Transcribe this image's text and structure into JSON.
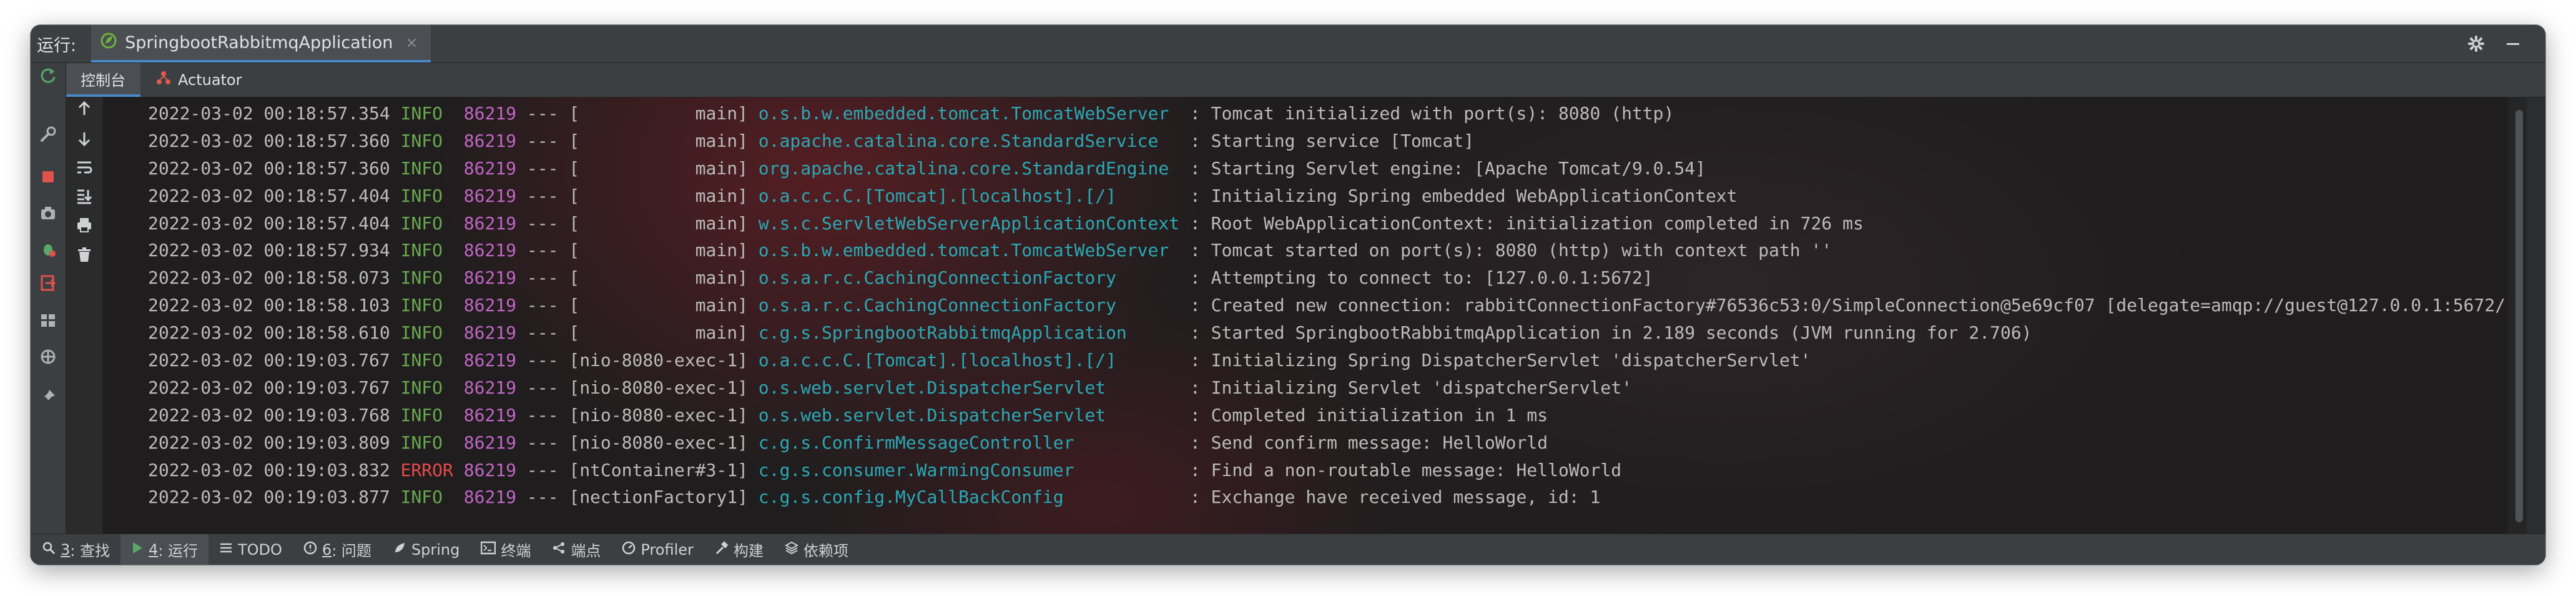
{
  "titlebar": {
    "run_label": "运行:",
    "tab_title": "SpringbootRabbitmqApplication",
    "tab_close": "×",
    "gear_icon": "gear-icon",
    "minimize_icon": "minimize-icon"
  },
  "subtabs": {
    "console": "控制台",
    "actuator": "Actuator"
  },
  "colors": {
    "info": "#6aa84f",
    "error": "#e8494c",
    "pid": "#c066c4",
    "logger": "#2aa9b5",
    "text": "#bbbbbb"
  },
  "log": [
    {
      "ts": "2022-03-02 00:18:57.354",
      "level": "INFO",
      "pid": "86219",
      "sep": "---",
      "thread": "[           main]",
      "logger": "o.s.b.w.embedded.tomcat.TomcatWebServer ",
      "msg": ": Tomcat initialized with port(s): 8080 (http)"
    },
    {
      "ts": "2022-03-02 00:18:57.360",
      "level": "INFO",
      "pid": "86219",
      "sep": "---",
      "thread": "[           main]",
      "logger": "o.apache.catalina.core.StandardService  ",
      "msg": ": Starting service [Tomcat]"
    },
    {
      "ts": "2022-03-02 00:18:57.360",
      "level": "INFO",
      "pid": "86219",
      "sep": "---",
      "thread": "[           main]",
      "logger": "org.apache.catalina.core.StandardEngine ",
      "msg": ": Starting Servlet engine: [Apache Tomcat/9.0.54]"
    },
    {
      "ts": "2022-03-02 00:18:57.404",
      "level": "INFO",
      "pid": "86219",
      "sep": "---",
      "thread": "[           main]",
      "logger": "o.a.c.c.C.[Tomcat].[localhost].[/]      ",
      "msg": ": Initializing Spring embedded WebApplicationContext"
    },
    {
      "ts": "2022-03-02 00:18:57.404",
      "level": "INFO",
      "pid": "86219",
      "sep": "---",
      "thread": "[           main]",
      "logger": "w.s.c.ServletWebServerApplicationContext",
      "msg": ": Root WebApplicationContext: initialization completed in 726 ms"
    },
    {
      "ts": "2022-03-02 00:18:57.934",
      "level": "INFO",
      "pid": "86219",
      "sep": "---",
      "thread": "[           main]",
      "logger": "o.s.b.w.embedded.tomcat.TomcatWebServer ",
      "msg": ": Tomcat started on port(s): 8080 (http) with context path ''"
    },
    {
      "ts": "2022-03-02 00:18:58.073",
      "level": "INFO",
      "pid": "86219",
      "sep": "---",
      "thread": "[           main]",
      "logger": "o.s.a.r.c.CachingConnectionFactory      ",
      "msg": ": Attempting to connect to: [127.0.0.1:5672]"
    },
    {
      "ts": "2022-03-02 00:18:58.103",
      "level": "INFO",
      "pid": "86219",
      "sep": "---",
      "thread": "[           main]",
      "logger": "o.s.a.r.c.CachingConnectionFactory      ",
      "msg": ": Created new connection: rabbitConnectionFactory#76536c53:0/SimpleConnection@5e69cf07 [delegate=amqp://guest@127.0.0.1:5672/,"
    },
    {
      "ts": "2022-03-02 00:18:58.610",
      "level": "INFO",
      "pid": "86219",
      "sep": "---",
      "thread": "[           main]",
      "logger": "c.g.s.SpringbootRabbitmqApplication     ",
      "msg": ": Started SpringbootRabbitmqApplication in 2.189 seconds (JVM running for 2.706)"
    },
    {
      "ts": "2022-03-02 00:19:03.767",
      "level": "INFO",
      "pid": "86219",
      "sep": "---",
      "thread": "[nio-8080-exec-1]",
      "logger": "o.a.c.c.C.[Tomcat].[localhost].[/]      ",
      "msg": ": Initializing Spring DispatcherServlet 'dispatcherServlet'"
    },
    {
      "ts": "2022-03-02 00:19:03.767",
      "level": "INFO",
      "pid": "86219",
      "sep": "---",
      "thread": "[nio-8080-exec-1]",
      "logger": "o.s.web.servlet.DispatcherServlet       ",
      "msg": ": Initializing Servlet 'dispatcherServlet'"
    },
    {
      "ts": "2022-03-02 00:19:03.768",
      "level": "INFO",
      "pid": "86219",
      "sep": "---",
      "thread": "[nio-8080-exec-1]",
      "logger": "o.s.web.servlet.DispatcherServlet       ",
      "msg": ": Completed initialization in 1 ms"
    },
    {
      "ts": "2022-03-02 00:19:03.809",
      "level": "INFO",
      "pid": "86219",
      "sep": "---",
      "thread": "[nio-8080-exec-1]",
      "logger": "c.g.s.ConfirmMessageController          ",
      "msg": ": Send confirm message: HelloWorld"
    },
    {
      "ts": "2022-03-02 00:19:03.832",
      "level": "ERROR",
      "pid": "86219",
      "sep": "---",
      "thread": "[ntContainer#3-1]",
      "logger": "c.g.s.consumer.WarmingConsumer          ",
      "msg": ": Find a non-routable message: HelloWorld"
    },
    {
      "ts": "2022-03-02 00:19:03.877",
      "level": "INFO",
      "pid": "86219",
      "sep": "---",
      "thread": "[nectionFactory1]",
      "logger": "c.g.s.config.MyCallBackConfig           ",
      "msg": ": Exchange have received message, id: 1"
    }
  ],
  "statusbar": [
    {
      "key": "3",
      "label": ": 查找",
      "icon": "search-icon"
    },
    {
      "key": "4",
      "label": ": 运行",
      "icon": "run-icon",
      "active": true
    },
    {
      "key": "",
      "label": "TODO",
      "icon": "todo-icon"
    },
    {
      "key": "6",
      "label": ": 问题",
      "icon": "problems-icon"
    },
    {
      "key": "",
      "label": "Spring",
      "icon": "spring-icon"
    },
    {
      "key": "",
      "label": "终端",
      "icon": "terminal-icon"
    },
    {
      "key": "",
      "label": "端点",
      "icon": "endpoints-icon"
    },
    {
      "key": "",
      "label": "Profiler",
      "icon": "profiler-icon"
    },
    {
      "key": "",
      "label": "构建",
      "icon": "build-icon"
    },
    {
      "key": "",
      "label": "依赖项",
      "icon": "dependencies-icon"
    }
  ]
}
